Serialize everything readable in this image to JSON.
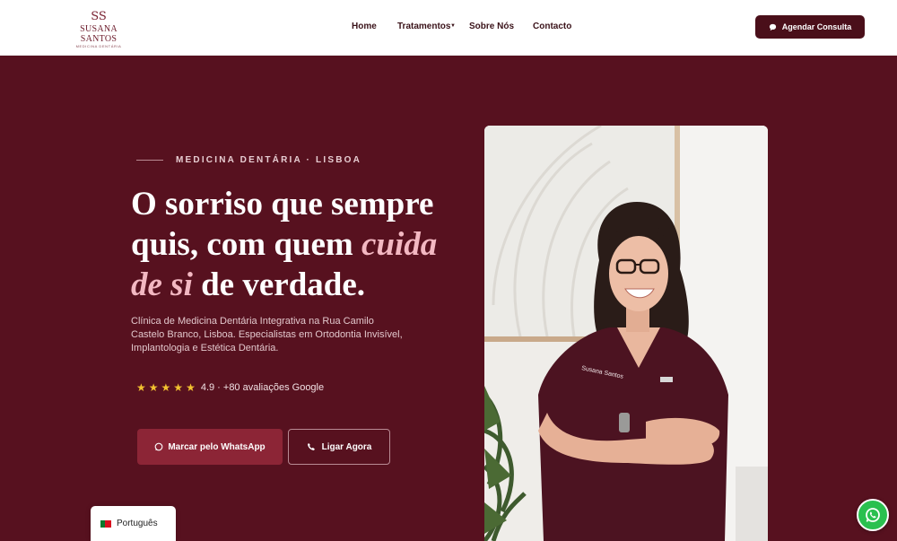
{
  "header": {
    "logo": {
      "mark": "SS",
      "name": "SUSANA SANTOS",
      "tagline": "MEDICINA DENTÁRIA"
    },
    "nav": {
      "home": "Home",
      "tratamentos": "Tratamentos",
      "sobre": "Sobre Nós",
      "contacto": "Contacto"
    },
    "cta_label": "Agendar Consulta"
  },
  "hero": {
    "kicker": "MEDICINA DENTÁRIA · LISBOA",
    "headline": {
      "part1": "O sorriso que sempre quis, com quem ",
      "emphasis": "cuida de si",
      "part2": " de verdade."
    },
    "description": "Clínica de Medicina Dentária Integrativa na Rua Camilo Castelo Branco, Lisboa. Especialistas em Ortodontia Invisível, Implantologia e Estética Dentária.",
    "rating": {
      "stars": 5,
      "text": "4.9 · +80 avaliações Google"
    },
    "whatsapp_label": "Marcar pelo WhatsApp",
    "call_label": "Ligar Agora",
    "photo_uniform_text": "Susana Santos"
  },
  "language": {
    "label": "Português"
  },
  "colors": {
    "brand": "#57111f",
    "brand_dark": "#4a0f1a",
    "accent": "#8c2536",
    "emphasis": "#f3b8c2",
    "star": "#f2c230",
    "whatsapp": "#2ac04f"
  },
  "icons": [
    "chat-bubble-icon",
    "phone-icon",
    "star-icon",
    "chevron-down-icon",
    "whatsapp-icon",
    "portugal-flag-icon"
  ]
}
